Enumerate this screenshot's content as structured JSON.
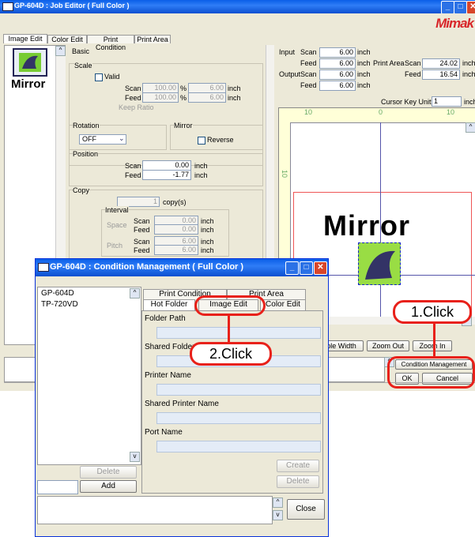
{
  "job_editor": {
    "title": "GP-604D : Job Editor ( Full Color )",
    "logo": "Mimak",
    "tabs": [
      "Image Edit",
      "Color Edit",
      "Print Condition",
      "Print Area"
    ],
    "thumb_text": "Mirror",
    "basic_label": "Basic",
    "scale": {
      "label": "Scale",
      "valid_label": "Valid",
      "scan_label": "Scan",
      "feed_label": "Feed",
      "scan_pct": "100.00",
      "feed_pct": "100.00",
      "pct_unit": "%",
      "scan_val": "6.00",
      "feed_val": "6.00",
      "unit": "inch",
      "keep_ratio": "Keep Ratio"
    },
    "rotation": {
      "label": "Rotation",
      "value": "OFF"
    },
    "mirror": {
      "label": "Mirror",
      "reverse": "Reverse"
    },
    "position": {
      "label": "Position",
      "scan_label": "Scan",
      "feed_label": "Feed",
      "scan_val": "0.00",
      "feed_val": "-1.77",
      "unit": "inch"
    },
    "copy": {
      "label": "Copy",
      "count": "1",
      "count_unit": "copy(s)",
      "interval": "Interval",
      "space": "Space",
      "pitch": "Pitch",
      "scan_label": "Scan",
      "feed_label": "Feed",
      "space_scan": "0.00",
      "space_feed": "0.00",
      "pitch_scan": "6.00",
      "pitch_feed": "6.00",
      "unit": "inch"
    },
    "info": {
      "input": "Input",
      "output": "Output",
      "scan": "Scan",
      "feed": "Feed",
      "in_scan": "6.00",
      "in_feed": "6.00",
      "out_scan": "6.00",
      "out_feed": "6.00",
      "unit": "inch",
      "print_area": "Print Area",
      "pa_scan": "24.02",
      "pa_feed": "16.54"
    },
    "cursor_key_unit": "Cursor Key Unit",
    "cursor_value": "1",
    "cursor_unit": "inch",
    "ruler": [
      "10",
      "0",
      "10"
    ],
    "vruler": "10",
    "preview_text": "Mirror",
    "buttons": {
      "width": "ple Width",
      "zoom_out": "Zoom Out",
      "zoom_in": "Zoom In",
      "cond_mgmt": "Condition Management",
      "ok": "OK",
      "cancel": "Cancel"
    }
  },
  "cond": {
    "title": "GP-604D : Condition Management ( Full Color )",
    "list": [
      "GP-604D",
      "TP-720VD"
    ],
    "delete": "Delete",
    "add": "Add",
    "tabs_row1": [
      "Print Condition",
      "Print Area"
    ],
    "tabs_row2": [
      "Hot Folder",
      "Image Edit",
      "Color Edit"
    ],
    "fields": [
      "Folder Path",
      "Shared Folder Name",
      "Printer Name",
      "Shared Printer Name",
      "Port Name"
    ],
    "create": "Create",
    "delete2": "Delete",
    "close": "Close"
  },
  "callouts": {
    "c1": "1.Click",
    "c2": "2.Click"
  }
}
